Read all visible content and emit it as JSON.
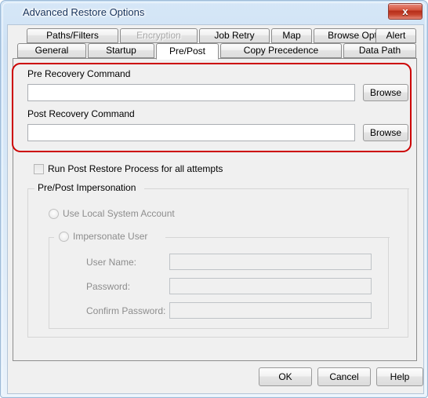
{
  "window": {
    "title": "Advanced Restore Options",
    "close_label": "x",
    "close_icon": "close-icon"
  },
  "tabs": {
    "row_top": [
      {
        "label": "Paths/Filters",
        "disabled": false,
        "active": false
      },
      {
        "label": "Encryption",
        "disabled": true,
        "active": false
      },
      {
        "label": "Job Retry",
        "disabled": false,
        "active": false
      },
      {
        "label": "Map",
        "disabled": false,
        "active": false
      },
      {
        "label": "Browse Options",
        "disabled": false,
        "active": false
      },
      {
        "label": "Alert",
        "disabled": false,
        "active": false
      }
    ],
    "row_bottom": [
      {
        "label": "General",
        "disabled": false,
        "active": false
      },
      {
        "label": "Startup",
        "disabled": false,
        "active": false
      },
      {
        "label": "Pre/Post",
        "disabled": false,
        "active": true
      },
      {
        "label": "Copy Precedence",
        "disabled": false,
        "active": false
      },
      {
        "label": "Data Path",
        "disabled": false,
        "active": false
      }
    ]
  },
  "commands": {
    "pre_label": "Pre Recovery Command",
    "pre_value": "",
    "pre_browse_label": "Browse",
    "post_label": "Post Recovery Command",
    "post_value": "",
    "post_browse_label": "Browse"
  },
  "options": {
    "run_post_restore_label": "Run Post Restore Process for all attempts",
    "run_post_restore_checked": false
  },
  "impersonation": {
    "group_label": "Pre/Post Impersonation",
    "local_system_label": "Use Local System Account",
    "local_system_selected": false,
    "impersonate_user_label": "Impersonate User",
    "impersonate_user_selected": false,
    "user_name_label": "User Name:",
    "user_name_value": "",
    "password_label": "Password:",
    "password_value": "",
    "confirm_password_label": "Confirm Password:",
    "confirm_password_value": ""
  },
  "buttons": {
    "ok_label": "OK",
    "cancel_label": "Cancel",
    "help_label": "Help"
  },
  "annotation": {
    "highlight_color": "#cc0000"
  }
}
